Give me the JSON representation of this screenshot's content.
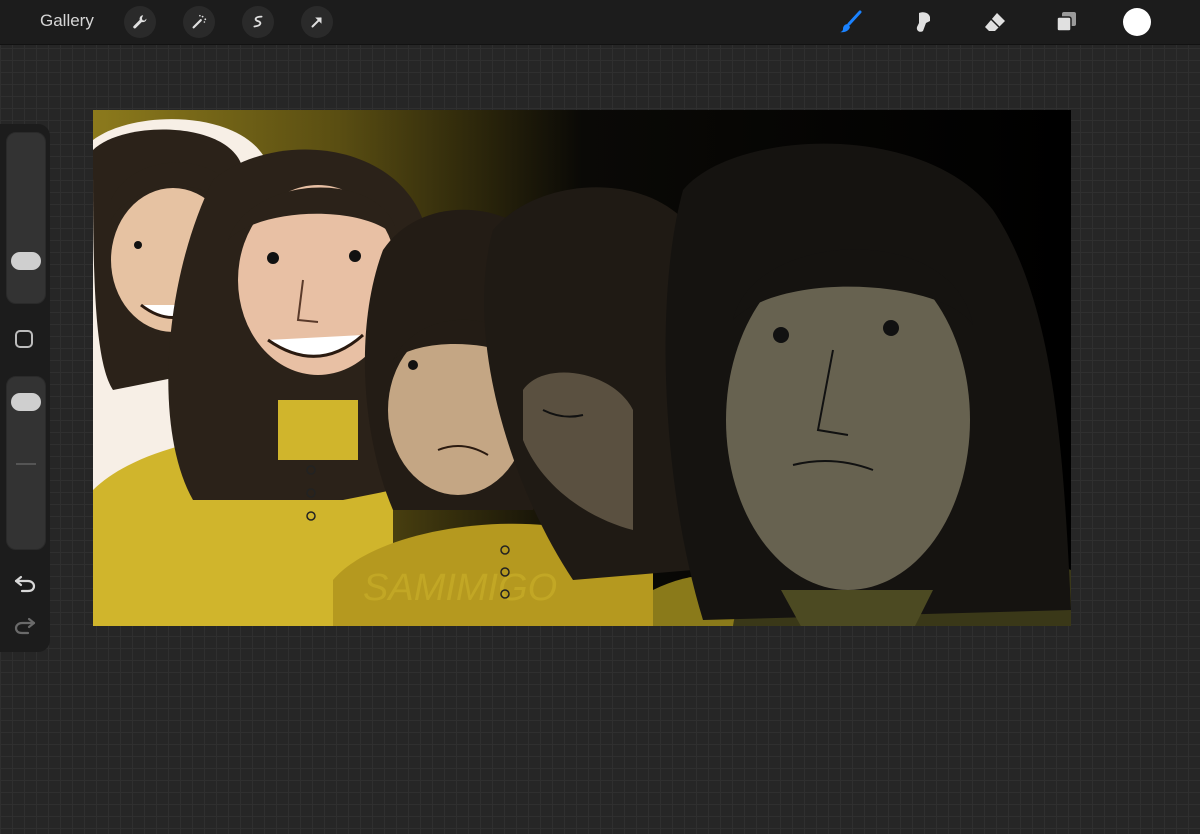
{
  "topbar": {
    "gallery_label": "Gallery",
    "left_tools": [
      {
        "icon": "wrench-icon",
        "label": "Actions"
      },
      {
        "icon": "magic-wand-icon",
        "label": "Adjustments"
      },
      {
        "icon": "selection-icon",
        "label": "Selection"
      },
      {
        "icon": "arrow-cursor-icon",
        "label": "Transform"
      }
    ],
    "right_tools": [
      {
        "icon": "brush-icon",
        "active": true
      },
      {
        "icon": "smudge-icon",
        "active": false
      },
      {
        "icon": "eraser-icon",
        "active": false
      },
      {
        "icon": "layers-icon",
        "active": false
      }
    ],
    "current_color": "#ffffff",
    "active_color": "#1a82ff"
  },
  "sidebar": {
    "brush_size_level": 0.2,
    "opacity_level": 0.08
  },
  "canvas": {
    "watermark": "SAMIMIGO",
    "colors": {
      "mustard": "#cfb22a",
      "hair": "#2b2219",
      "skin_light": "#e8c0a4",
      "background_dark": "#000000"
    }
  }
}
